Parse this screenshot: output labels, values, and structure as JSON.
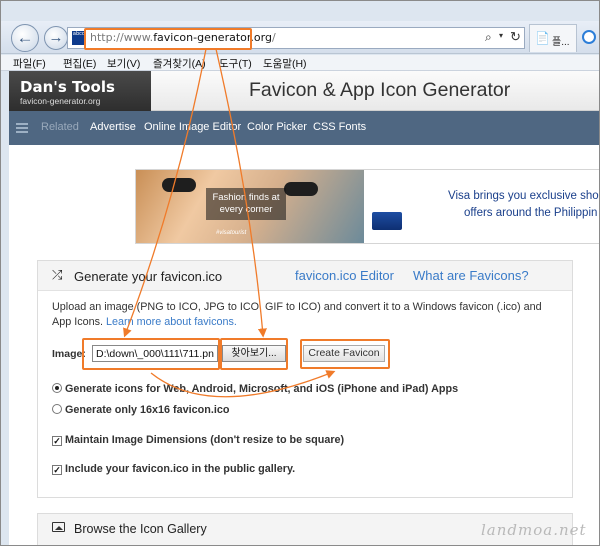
{
  "browser": {
    "url_prefix": "http://www.",
    "url_domain": "favicon-generator.org",
    "url_suffix": "/",
    "site_icon_text": "abcd",
    "tab_label": "플..."
  },
  "menu": [
    "파일(F)",
    "편집(E)",
    "보기(V)",
    "즐겨찾기(A)",
    "도구(T)",
    "도움말(H)"
  ],
  "header": {
    "logo_title": "Dan's Tools",
    "logo_sub": "favicon-generator.org",
    "site_title": "Favicon & App Icon Generator"
  },
  "nav": {
    "related": "Related",
    "links": [
      "Advertise",
      "Online Image Editor",
      "Color Picker",
      "CSS Fonts"
    ]
  },
  "ad": {
    "badge_line1": "Fashion finds at",
    "badge_line2": "every corner",
    "tag": "#visatourist",
    "line1": "Visa brings you exclusive sho",
    "line2": "offers around the Philippin"
  },
  "panel": {
    "title": "Generate your favicon.ico",
    "editor_link": "favicon.ico Editor",
    "whatare_link": "What are Favicons?",
    "desc": "Upload an image (PNG to ICO, JPG to ICO, GIF to ICO) and convert it to a Windows favicon (.ico) and App Icons.",
    "learn_more": "Learn more about favicons.",
    "image_label": "Image:",
    "file_value": "D:\\down\\_000\\111\\711.pn",
    "browse_label": "찾아보기...",
    "create_label": "Create Favicon",
    "option1": "Generate icons for Web, Android, Microsoft, and iOS (iPhone and iPad) Apps",
    "option2": "Generate only 16x16 favicon.ico",
    "check1": "Maintain Image Dimensions (don't resize to be square)",
    "check2": "Include your favicon.ico in the public gallery."
  },
  "gallery": {
    "title": "Browse the Icon Gallery"
  },
  "watermark": "landmoa.net",
  "colors": {
    "highlight": "#f07b2a",
    "nav_bg": "#4f6782",
    "link": "#3a7bc8"
  }
}
